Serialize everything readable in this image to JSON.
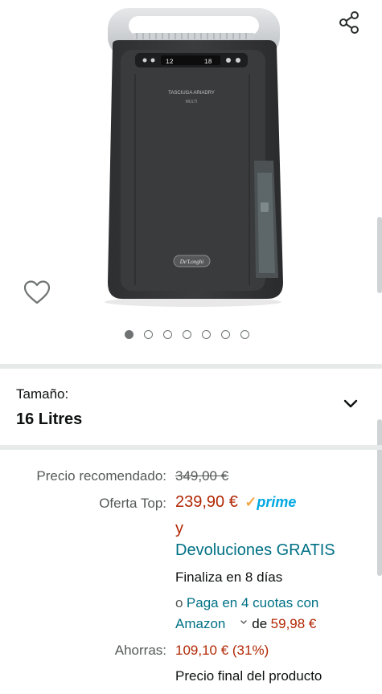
{
  "gallery": {
    "brand": "De'Longhi",
    "model": "TASCIUGA ARIADRY",
    "model_sub": "MULTI",
    "panel_readout_left": "12",
    "panel_readout_right": "18",
    "image_count": 7,
    "active_index": 0
  },
  "size": {
    "label": "Tamaño:",
    "value": "16 Litres"
  },
  "price": {
    "list_label": "Precio recomendado:",
    "list_value": "349,00 €",
    "deal_label": "Oferta Top:",
    "deal_value": "239,90 €",
    "prime_check": "✓",
    "prime": "prime",
    "and": "y",
    "returns": "Devoluciones GRATIS",
    "ends": "Finaliza en 8 días",
    "installments_prefix": "o",
    "installments_link": "Paga en 4 cuotas con",
    "installments_link2": "Amazon",
    "installments_de": "de",
    "installments_amount": "59,98 €",
    "savings_label": "Ahorras:",
    "savings_value": "109,10 € (31%)",
    "final_price": "Precio final del producto"
  },
  "colors": {
    "deal_red": "#b12704",
    "link_teal": "#007185",
    "prime_blue": "#00a8e1",
    "divider": "#e6ebea"
  },
  "icons": {
    "share": "share-icon",
    "favorite": "heart-icon",
    "dropdown": "chevron-down-icon",
    "installments_caret": "chevron-down-small-icon"
  }
}
